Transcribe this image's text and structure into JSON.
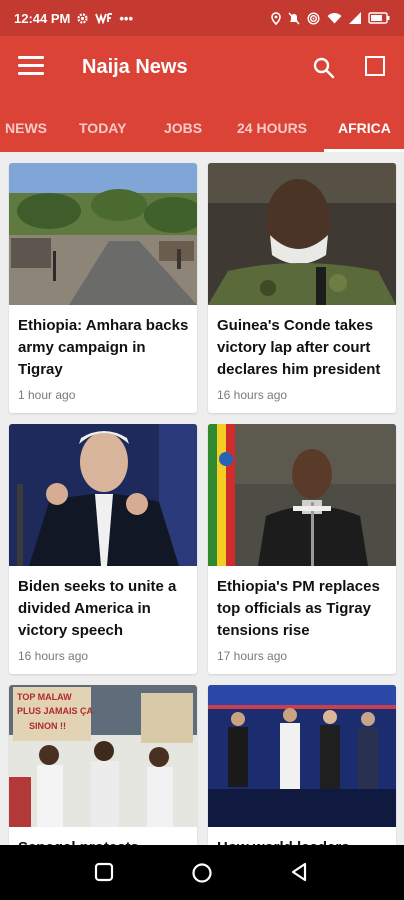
{
  "status_bar": {
    "time": "12:44 PM",
    "dots": "•••"
  },
  "app_bar": {
    "title": "Naija News"
  },
  "tabs": [
    {
      "label": "NEWS",
      "active": false
    },
    {
      "label": "TODAY",
      "active": false
    },
    {
      "label": "JOBS",
      "active": false
    },
    {
      "label": "24 HOURS",
      "active": false
    },
    {
      "label": "AFRICA",
      "active": true
    }
  ],
  "articles": [
    {
      "title": "Ethiopia: Amhara backs army campaign in Tigray",
      "time": "1 hour ago",
      "image": "road-village-photo"
    },
    {
      "title": "Guinea's Conde takes victory lap after court declares him president",
      "time": "16 hours ago",
      "image": "man-with-mask-photo"
    },
    {
      "title": "Biden seeks to unite a divided America in victory speech",
      "time": "16 hours ago",
      "image": "biden-cheering-photo"
    },
    {
      "title": "Ethiopia's PM replaces top officials as Tigray tensions rise",
      "time": "17 hours ago",
      "image": "pm-at-podium-photo"
    },
    {
      "title": "Senegal protests",
      "time": "",
      "image": "protest-signs-photo"
    },
    {
      "title": "How world leaders",
      "time": "",
      "image": "stage-celebration-photo"
    }
  ],
  "colors": {
    "status_bar": "#c43a31",
    "app_bar": "#dc4337",
    "background": "#eeeeee"
  }
}
